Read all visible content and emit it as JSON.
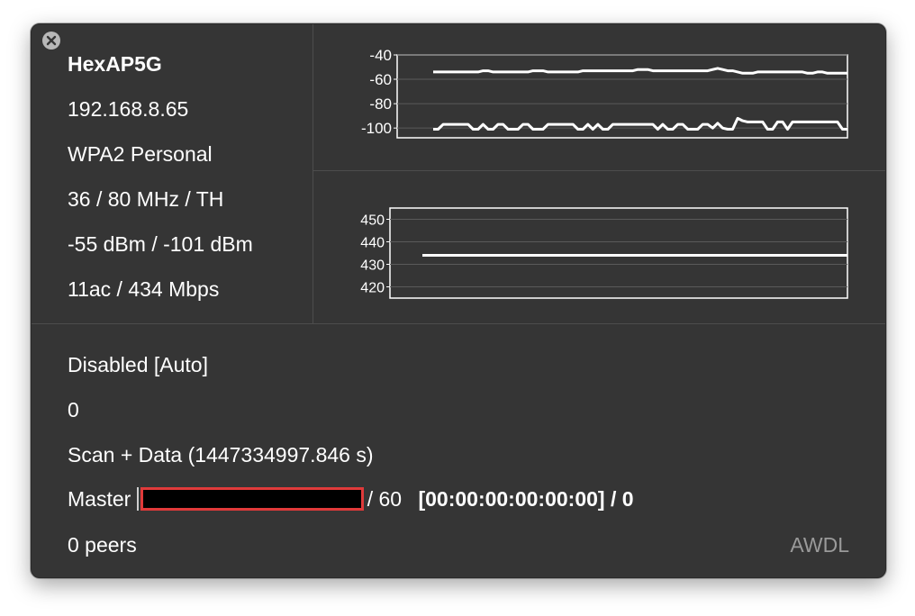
{
  "network": {
    "ssid": "HexAP5G",
    "ip": "192.168.8.65",
    "security": "WPA2 Personal",
    "channel": "36 / 80 MHz / TH",
    "signal": "-55 dBm / -101 dBm",
    "phy": "11ac / 434 Mbps"
  },
  "awdl": {
    "status": "Disabled [Auto]",
    "count": "0",
    "mode": "Scan + Data (1447334997.846 s)",
    "role_prefix": "Master",
    "role_suffix": "/ 60",
    "mac_info": "[00:00:00:00:00:00] / 0",
    "peers": "0 peers",
    "label": "AWDL"
  },
  "chart_data": [
    {
      "type": "line",
      "y_ticks": [
        "-40",
        "-60",
        "-80",
        "-100"
      ],
      "ylim": [
        -108,
        -40
      ],
      "grid": true,
      "series": [
        {
          "values": [
            -54,
            -54,
            -54,
            -54,
            -54,
            -54,
            -54,
            -54,
            -54,
            -54,
            -53,
            -53,
            -54,
            -54,
            -54,
            -54,
            -54,
            -54,
            -54,
            -54,
            -53,
            -53,
            -53,
            -54,
            -54,
            -54,
            -54,
            -54,
            -54,
            -54,
            -53,
            -53,
            -53,
            -53,
            -53,
            -53,
            -53,
            -53,
            -53,
            -53,
            -53,
            -52,
            -52,
            -52,
            -53,
            -53,
            -53,
            -53,
            -53,
            -53,
            -53,
            -53,
            -53,
            -53,
            -53,
            -53,
            -52,
            -51,
            -52,
            -53,
            -53,
            -54,
            -55,
            -55,
            -55,
            -54,
            -54,
            -54,
            -54,
            -54,
            -54,
            -54,
            -54,
            -54,
            -54,
            -55,
            -55,
            -54,
            -54,
            -55,
            -55,
            -55,
            -55,
            -55
          ]
        },
        {
          "values": [
            -101,
            -101,
            -97,
            -97,
            -97,
            -97,
            -97,
            -97,
            -101,
            -101,
            -97,
            -101,
            -101,
            -97,
            -97,
            -101,
            -101,
            -101,
            -97,
            -97,
            -101,
            -101,
            -101,
            -97,
            -97,
            -97,
            -97,
            -97,
            -97,
            -101,
            -101,
            -97,
            -101,
            -97,
            -101,
            -101,
            -97,
            -97,
            -97,
            -97,
            -97,
            -97,
            -97,
            -97,
            -97,
            -101,
            -97,
            -101,
            -101,
            -97,
            -97,
            -101,
            -101,
            -101,
            -97,
            -97,
            -100,
            -96,
            -100,
            -101,
            -101,
            -92,
            -94,
            -95,
            -95,
            -95,
            -95,
            -101,
            -101,
            -95,
            -95,
            -101,
            -95,
            -95,
            -95,
            -95,
            -95,
            -95,
            -95,
            -95,
            -95,
            -95,
            -101,
            -101
          ]
        }
      ]
    },
    {
      "type": "line",
      "y_ticks": [
        "450",
        "440",
        "430",
        "420"
      ],
      "ylim": [
        415,
        455
      ],
      "grid": true,
      "series": [
        {
          "values": [
            434,
            434,
            434,
            434,
            434,
            434,
            434,
            434,
            434,
            434,
            434,
            434,
            434,
            434,
            434,
            434,
            434,
            434,
            434,
            434
          ]
        }
      ]
    }
  ]
}
